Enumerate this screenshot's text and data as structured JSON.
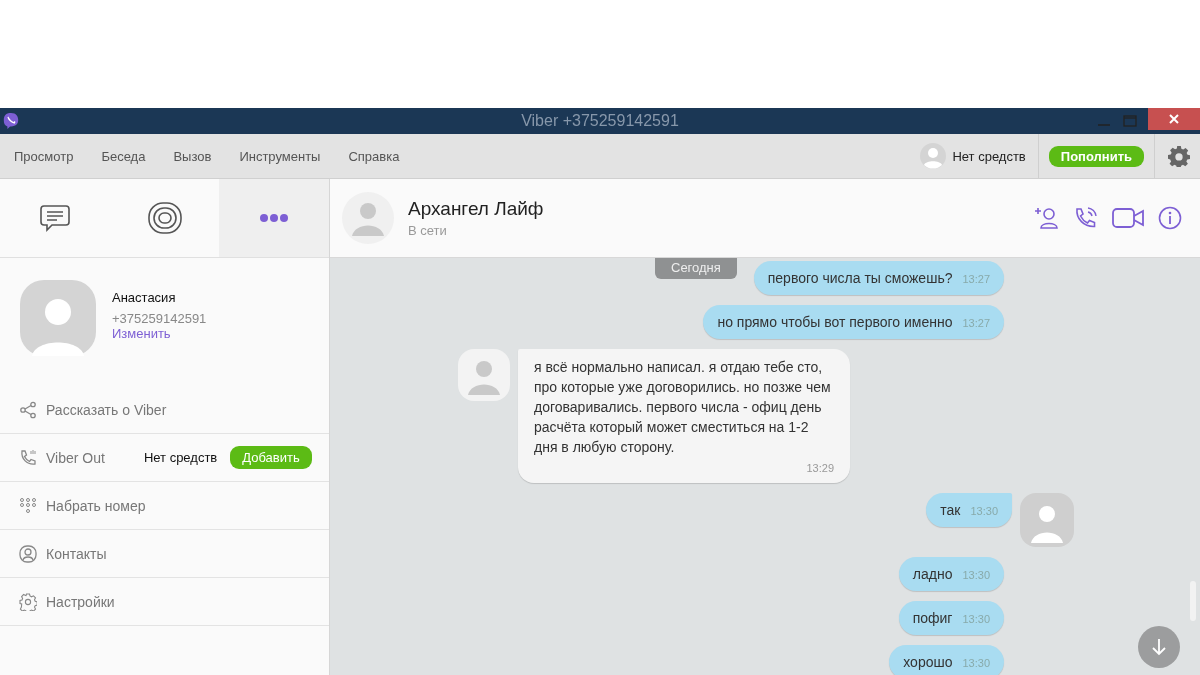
{
  "window": {
    "title": "Viber +375259142591"
  },
  "menu": [
    "Просмотр",
    "Беседа",
    "Вызов",
    "Инструменты",
    "Справка"
  ],
  "balance": {
    "status": "Нет средств",
    "button": "Пополнить"
  },
  "tabs": [
    {
      "kind": "chats",
      "selected": false
    },
    {
      "kind": "public",
      "selected": false
    },
    {
      "kind": "more",
      "selected": true
    }
  ],
  "profile": {
    "name": "Анастасия",
    "phone": "+375259142591",
    "edit": "Изменить"
  },
  "options": [
    {
      "kind": "share",
      "label": "Рассказать о Viber"
    },
    {
      "kind": "out",
      "label": "Viber Out",
      "status": "Нет средств",
      "button": "Добавить"
    },
    {
      "kind": "dial",
      "label": "Набрать номер"
    },
    {
      "kind": "contacts",
      "label": "Контакты"
    },
    {
      "kind": "settings",
      "label": "Настройки"
    }
  ],
  "chat": {
    "name": "Архангел Лайф",
    "status": "В сети",
    "date_badge": "Сегодня"
  },
  "messages": [
    {
      "kind": "out",
      "text": "первого числа ты сможешь?",
      "time": "13:27",
      "avatar": false
    },
    {
      "kind": "out",
      "text": "но прямо чтобы вот первого именно",
      "time": "13:27",
      "avatar": false
    },
    {
      "kind": "in",
      "text": "я всё нормально написал. я отдаю тебе сто, про которые уже договорились. но позже чем договаривались. первого числа - офиц день расчёта который может сместиться на 1-2 дня в любую сторону.",
      "time": "13:29",
      "avatar": true
    },
    {
      "kind": "out",
      "text": "так",
      "time": "13:30",
      "avatar": true
    },
    {
      "kind": "out",
      "text": "ладно",
      "time": "13:30",
      "avatar": false
    },
    {
      "kind": "out",
      "text": "пофиг",
      "time": "13:30",
      "avatar": false
    },
    {
      "kind": "out",
      "text": "хорошо",
      "time": "13:30",
      "avatar": false
    }
  ]
}
